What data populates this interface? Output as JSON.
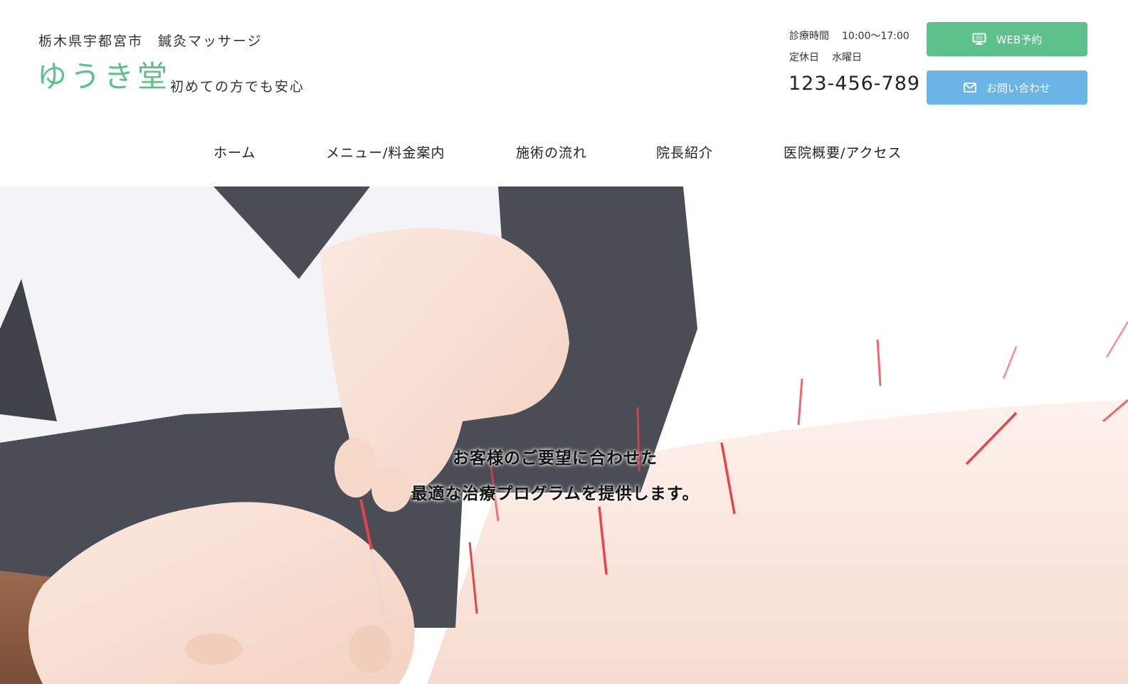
{
  "header": {
    "tagline": "栃木県宇都宮市　鍼灸マッサージ",
    "logo": "ゆうき堂",
    "sublogo": "初めての方でも安心",
    "hours_label": "診療時間",
    "hours_value": "10:00〜17:00",
    "closed_label": "定休日",
    "closed_value": "水曜日",
    "phone": "123-456-789",
    "web_button": "WEB予約",
    "contact_button": "お問い合わせ",
    "web_icon": "monitor-icon",
    "contact_icon": "mail-icon"
  },
  "nav": {
    "items": [
      "ホーム",
      "メニュー/料金案内",
      "施術の流れ",
      "院長紹介",
      "医院概要/アクセス"
    ]
  },
  "hero": {
    "line1": "お客様のご要望に合わせた",
    "line2": "最適な治療プログラムを提供します。"
  },
  "colors": {
    "brand_green": "#5cc18a",
    "contact_blue": "#6ab4e6",
    "needle_red": "#e8424a"
  }
}
